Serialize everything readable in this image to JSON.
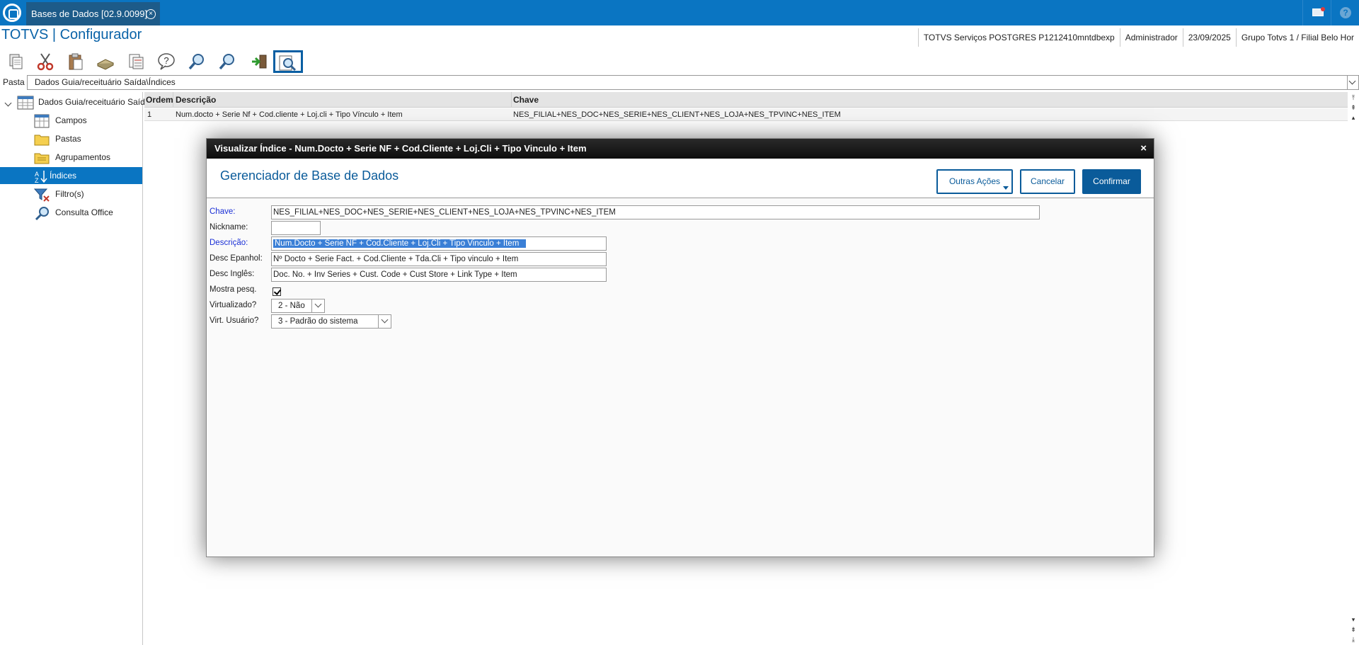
{
  "tab": {
    "title": "Bases de Dados [02.9.0099]",
    "close": "×"
  },
  "header": {
    "app_title": "TOTVS | Configurador",
    "status": [
      "TOTVS Serviços POSTGRES P1212410mntdbexp",
      "Administrador",
      "23/09/2025",
      "Grupo Totvs 1 / Filial Belo Hor"
    ]
  },
  "toolbar": {
    "buttons": [
      "copy-icon",
      "cut-icon",
      "paste-icon",
      "book-icon",
      "notes-icon",
      "help-icon",
      "search-icon",
      "find-next-icon",
      "exit-icon",
      "view-icon"
    ]
  },
  "pasta": {
    "label": "Pasta",
    "value": "Dados Guia/receituário Saída\\Índices"
  },
  "tree": {
    "root": "Dados Guia/receituário Saída",
    "items": [
      "Campos",
      "Pastas",
      "Agrupamentos",
      "Índices",
      "Filtro(s)",
      "Consulta Office"
    ],
    "selected": "Índices"
  },
  "grid": {
    "columns": [
      "Ordem",
      "Descrição",
      "Chave"
    ],
    "rows": [
      [
        "1",
        "Num.docto + Serie Nf + Cod.cliente + Loj.cli + Tipo Vínculo + Item",
        "NES_FILIAL+NES_DOC+NES_SERIE+NES_CLIENT+NES_LOJA+NES_TPVINC+NES_ITEM"
      ]
    ]
  },
  "modal": {
    "title": "Visualizar Índice - Num.Docto + Serie NF + Cod.Cliente + Loj.Cli + Tipo Vinculo + Item",
    "close": "×",
    "heading": "Gerenciador de Base de Dados",
    "buttons": {
      "other": "Outras Ações",
      "cancel": "Cancelar",
      "confirm": "Confirmar"
    },
    "fields": {
      "chave_label": "Chave:",
      "chave_value": "NES_FILIAL+NES_DOC+NES_SERIE+NES_CLIENT+NES_LOJA+NES_TPVINC+NES_ITEM",
      "nickname_label": "Nickname:",
      "nickname_value": "",
      "descricao_label": "Descrição:",
      "descricao_value": "Num.Docto + Serie NF + Cod.Cliente + Loj.Cli + Tipo Vinculo + Item",
      "desc_espanhol_label": "Desc Epanhol:",
      "desc_espanhol_value": "Nº Docto + Serie Fact. + Cod.Cliente + Tda.Cli + Tipo vinculo + Item",
      "desc_ingles_label": "Desc Inglês:",
      "desc_ingles_value": "Doc. No. + Inv Series + Cust. Code + Cust Store + Link Type + Item",
      "mostra_label": "Mostra pesq.",
      "mostra_checked": true,
      "virtualizado_label": "Virtualizado?",
      "virtualizado_value": "2 - Não",
      "virt_usuario_label": "Virt. Usuário?",
      "virt_usuario_value": "3 - Padrão do sistema"
    }
  },
  "colors": {
    "brand": "#0a75c2",
    "dark_blue": "#0a5b9a",
    "selection": "#3a7fd6"
  }
}
